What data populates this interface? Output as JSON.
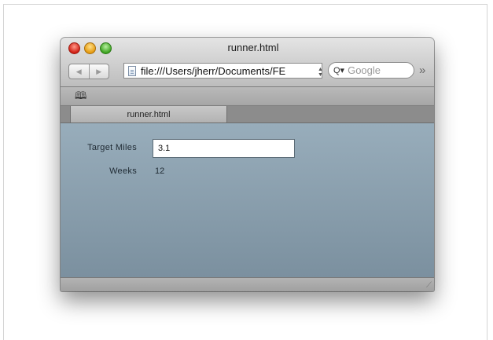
{
  "window": {
    "title": "runner.html",
    "url": "file:///Users/jherr/Documents/FE",
    "search_placeholder": "Google",
    "tab_label": "runner.html",
    "icons": [
      "close-button",
      "minimize-button",
      "zoom-button",
      "back-icon",
      "forward-icon",
      "page-icon",
      "search-icon",
      "overflow-chevron-icon",
      "bookmarks-icon",
      "resize-grip-icon"
    ]
  },
  "form": {
    "target_miles_label": "Target Miles",
    "target_miles_value": "3.1",
    "weeks_label": "Weeks",
    "weeks_value": "12"
  }
}
